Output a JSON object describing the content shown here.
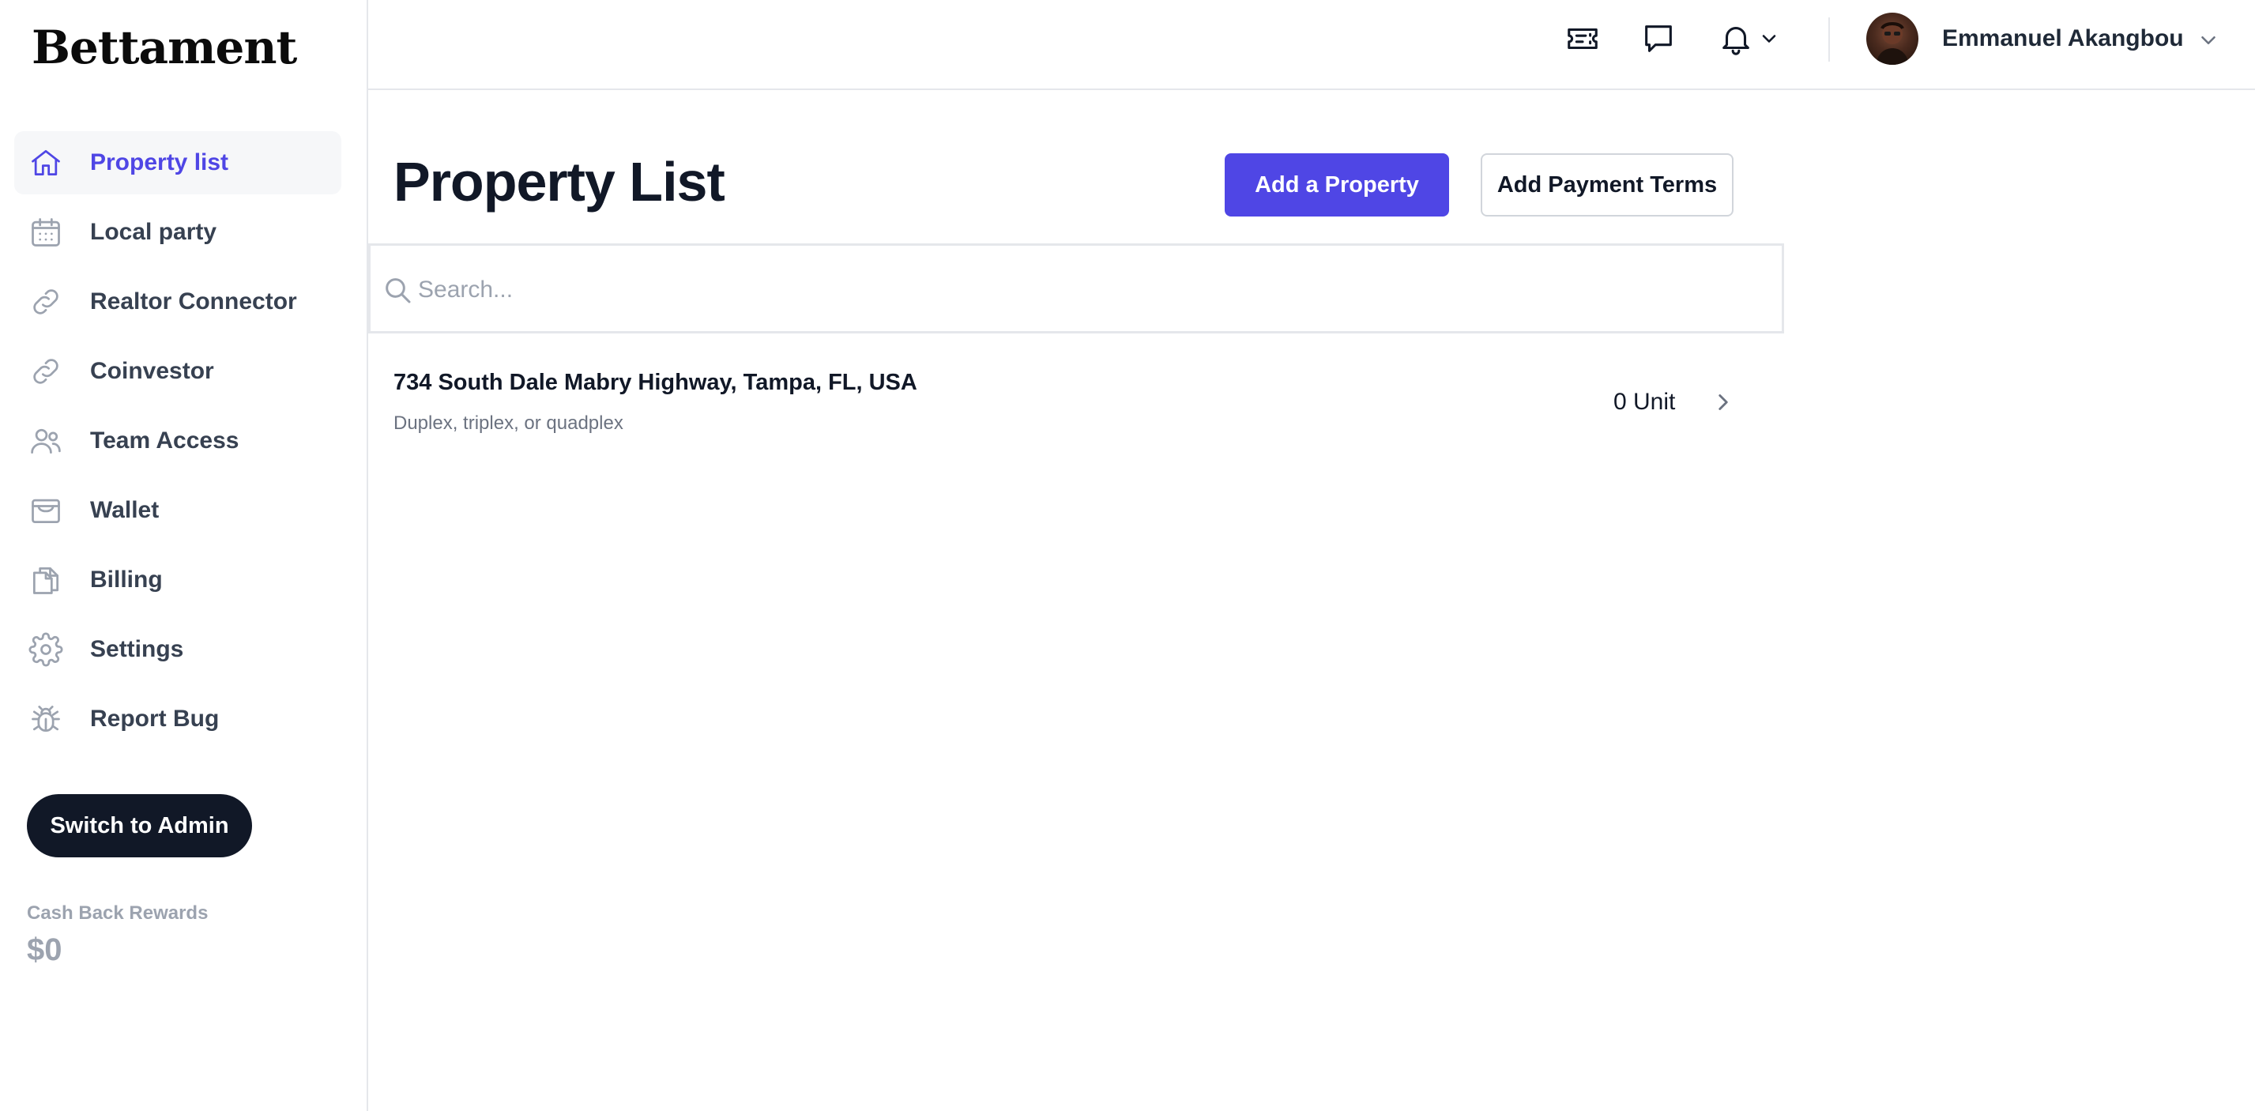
{
  "brand": {
    "logo_text": "Bettament"
  },
  "sidebar": {
    "items": [
      {
        "label": "Property list",
        "icon": "home-icon",
        "active": true
      },
      {
        "label": "Local party",
        "icon": "calendar-icon"
      },
      {
        "label": "Realtor Connector",
        "icon": "link-icon"
      },
      {
        "label": "Coinvestor",
        "icon": "link-icon"
      },
      {
        "label": "Team Access",
        "icon": "users-icon"
      },
      {
        "label": "Wallet",
        "icon": "wallet-icon"
      },
      {
        "label": "Billing",
        "icon": "document-icon"
      },
      {
        "label": "Settings",
        "icon": "gear-icon"
      },
      {
        "label": "Report Bug",
        "icon": "bug-icon"
      }
    ],
    "switch_label": "Switch to Admin",
    "rewards": {
      "label": "Cash Back Rewards",
      "value": "$0"
    }
  },
  "header": {
    "icons": [
      "ticket-icon",
      "chat-icon",
      "bell-icon",
      "chevron-down-icon"
    ],
    "user": {
      "name": "Emmanuel Akangbou"
    }
  },
  "main": {
    "title": "Property List",
    "add_property_label": "Add a Property",
    "add_payment_terms_label": "Add Payment Terms",
    "search": {
      "placeholder": "Search...",
      "value": ""
    },
    "properties": [
      {
        "address": "734 South Dale Mabry Highway, Tampa, FL, USA",
        "type": "Duplex, triplex, or quadplex",
        "units": "0 Unit"
      }
    ]
  },
  "colors": {
    "accent": "#4f46e5",
    "dark_button": "#111827",
    "muted_text": "#9ca3af"
  }
}
